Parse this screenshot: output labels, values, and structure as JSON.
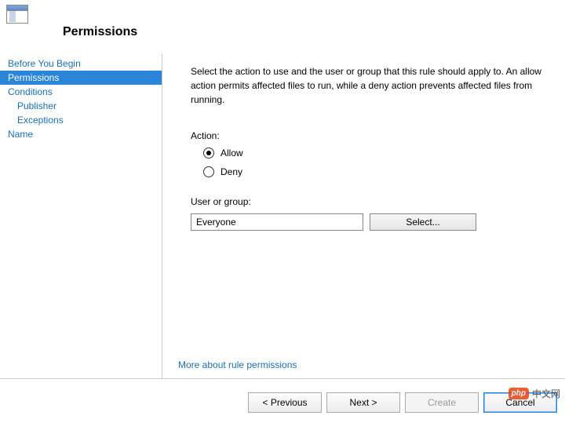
{
  "header": {
    "title": "Permissions"
  },
  "sidebar": {
    "items": [
      "Before You Begin",
      "Permissions",
      "Conditions",
      "Publisher",
      "Exceptions",
      "Name"
    ]
  },
  "content": {
    "instructions": "Select the action to use and the user or group that this rule should apply to. An allow action permits affected files to run, while a deny action prevents affected files from running.",
    "action_label": "Action:",
    "allow_label": "Allow",
    "deny_label": "Deny",
    "user_group_label": "User or group:",
    "user_group_value": "Everyone",
    "select_button": "Select...",
    "help_link": "More about rule permissions"
  },
  "footer": {
    "previous": "< Previous",
    "next": "Next >",
    "create": "Create",
    "cancel": "Cancel"
  },
  "watermark": {
    "badge": "php",
    "text": "中文网"
  }
}
